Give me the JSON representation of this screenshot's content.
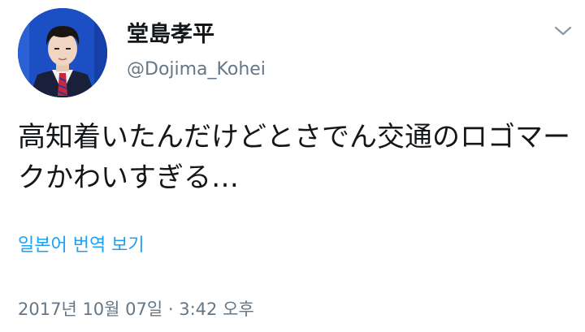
{
  "tweet": {
    "display_name": "堂島孝平",
    "handle": "@Dojima_Kohei",
    "text": "高知着いたんだけどとさでん交通のロゴマークかわいすぎる…",
    "translate_label": "일본어 번역 보기",
    "timestamp": "2017년 10월 07일 · 3:42 오후"
  },
  "icons": {
    "menu": "chevron-down-icon",
    "avatar": "profile-photo"
  },
  "colors": {
    "link": "#1da1f2",
    "secondary_text": "#657786",
    "primary_text": "#14171a",
    "avatar_background": "#1d4fc4"
  }
}
